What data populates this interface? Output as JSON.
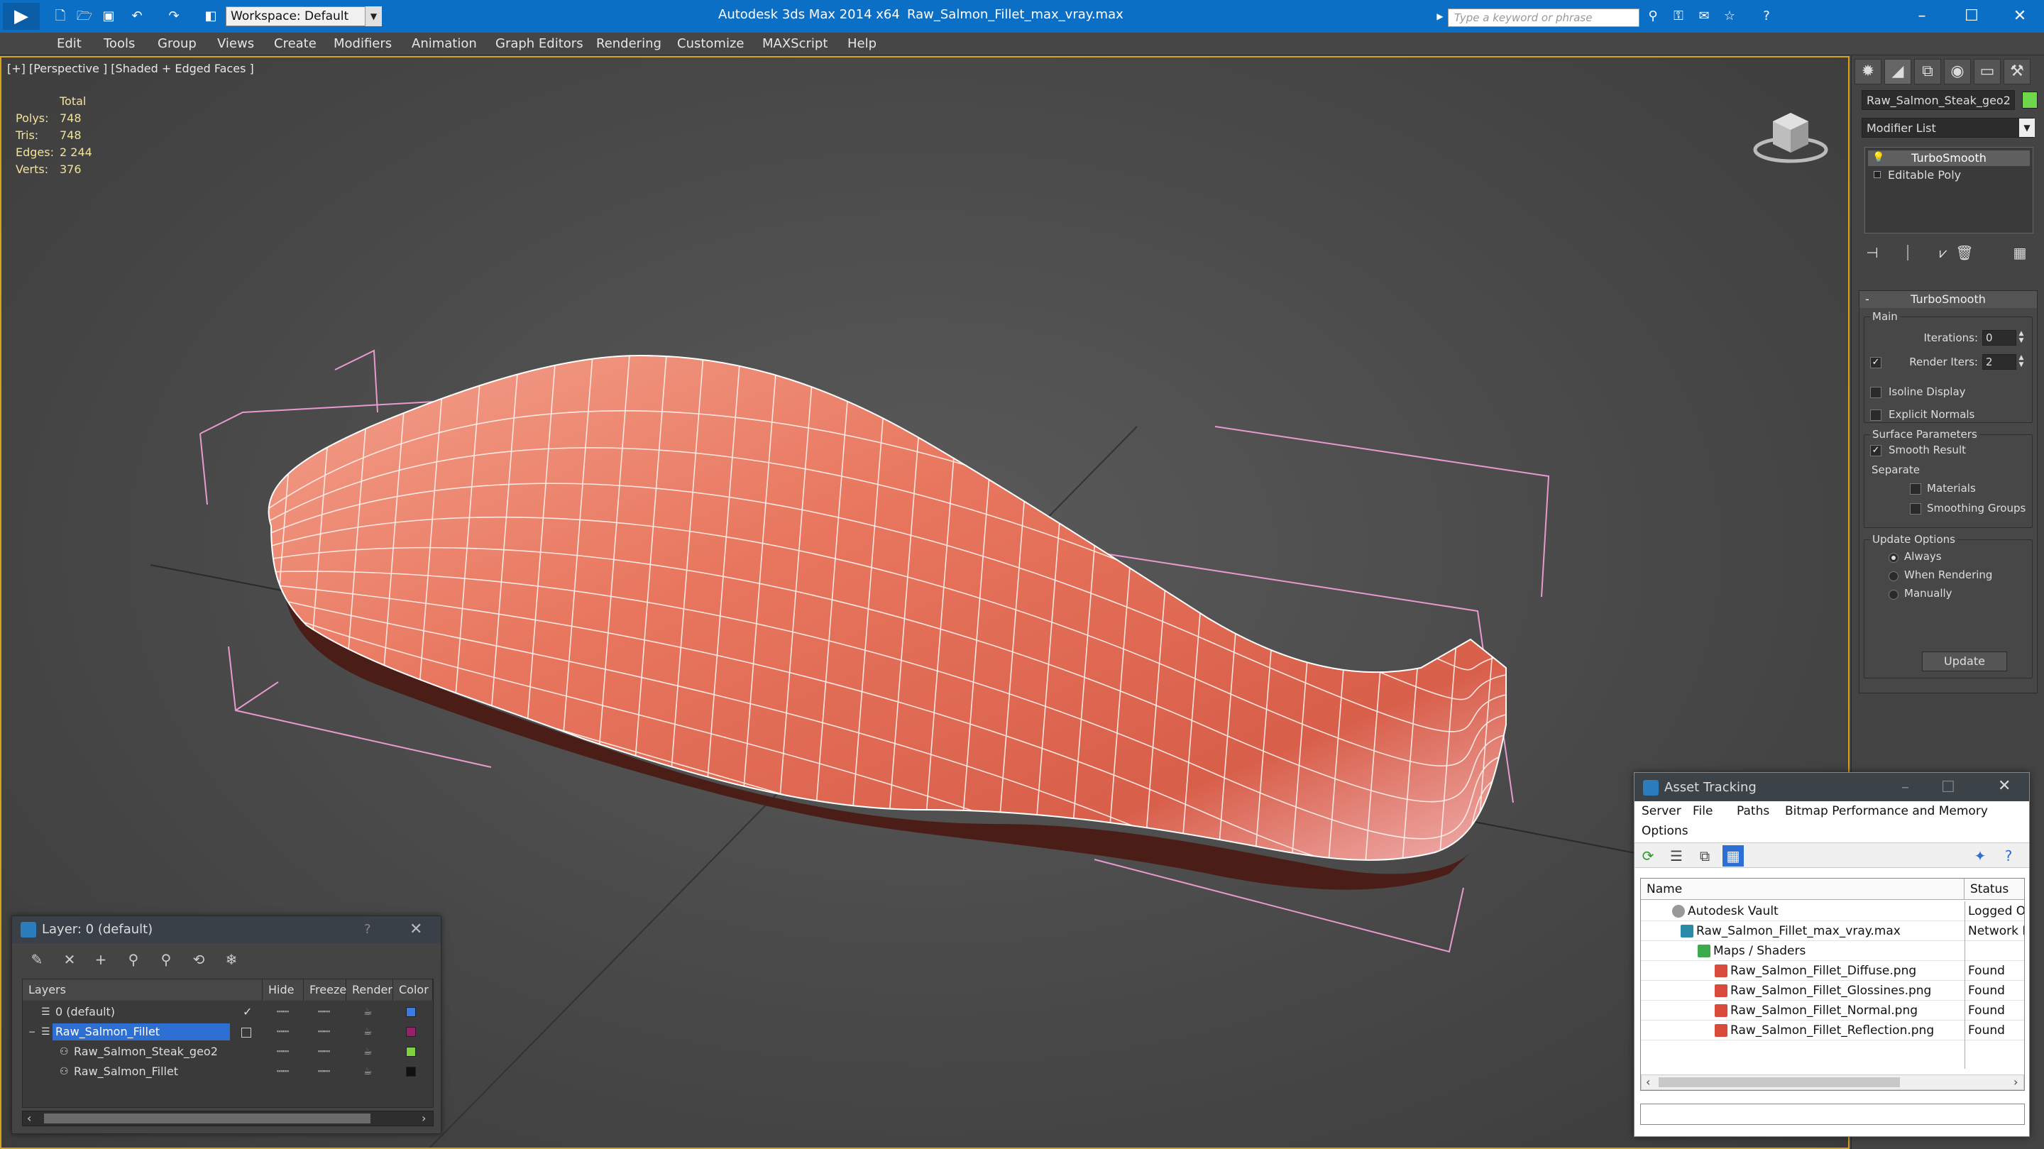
{
  "title_bar": {
    "app_title": "Autodesk 3ds Max  2014 x64",
    "file_title": "Raw_Salmon_Fillet_max_vray.max",
    "workspace_value": "Workspace: Default",
    "search_placeholder": "Type a keyword or phrase",
    "accent": "#0b6fc6"
  },
  "menu": {
    "items": [
      "Edit",
      "Tools",
      "Group",
      "Views",
      "Create",
      "Modifiers",
      "Animation",
      "Graph Editors",
      "Rendering",
      "Customize",
      "MAXScript",
      "Help"
    ]
  },
  "viewport": {
    "label": "[+] [Perspective ] [Shaded + Edged Faces ]",
    "stats": {
      "header": "Total",
      "rows": [
        {
          "label": "Polys:",
          "value": "748"
        },
        {
          "label": "Tris:",
          "value": "748"
        },
        {
          "label": "Edges:",
          "value": "2 244"
        },
        {
          "label": "Verts:",
          "value": "376"
        }
      ]
    }
  },
  "command_panel": {
    "object_name": "Raw_Salmon_Steak_geo2",
    "object_color": "#6dd84c",
    "modifier_list": "Modifier List",
    "stack": [
      "TurboSmooth",
      "Editable Poly"
    ],
    "rollout_title": "TurboSmooth",
    "main_group": "Main",
    "iterations_label": "Iterations:",
    "iterations_value": "0",
    "render_iters_label": "Render Iters:",
    "render_iters_value": "2",
    "render_iters_checked": true,
    "isoline_label": "Isoline Display",
    "explicit_normals_label": "Explicit Normals",
    "surface_group": "Surface Parameters",
    "smooth_result_label": "Smooth Result",
    "separate_label": "Separate",
    "materials_label": "Materials",
    "smoothing_groups_label": "Smoothing Groups",
    "update_group": "Update Options",
    "radio_always": "Always",
    "radio_when_rendering": "When Rendering",
    "radio_manually": "Manually",
    "update_button": "Update"
  },
  "layer_dialog": {
    "title": "Layer: 0 (default)",
    "help": "?",
    "columns": [
      "Layers",
      "Hide",
      "Freeze",
      "Render",
      "Color"
    ],
    "rows": [
      {
        "name": "0 (default)",
        "color": "#3b7be0",
        "indent": 1
      },
      {
        "name": "Raw_Salmon_Fillet",
        "color": "#9a1f6b",
        "indent": 1,
        "selected": true
      },
      {
        "name": "Raw_Salmon_Steak_geo2",
        "color": "#7ed23f",
        "indent": 2
      },
      {
        "name": "Raw_Salmon_Fillet",
        "color": "#111111",
        "indent": 2
      }
    ]
  },
  "asset_tracking": {
    "title": "Asset Tracking",
    "menu": [
      "Server",
      "File",
      "Paths",
      "Bitmap Performance and Memory",
      "Options"
    ],
    "columns": [
      "Name",
      "Status"
    ],
    "rows": [
      {
        "name": "Autodesk Vault",
        "status": "Logged O",
        "indent": 1,
        "icon": "vault-icon"
      },
      {
        "name": "Raw_Salmon_Fillet_max_vray.max",
        "status": "Network I",
        "indent": 2,
        "icon": "max-file-icon"
      },
      {
        "name": "Maps / Shaders",
        "status": "",
        "indent": 3,
        "icon": "maps-icon"
      },
      {
        "name": "Raw_Salmon_Fillet_Diffuse.png",
        "status": "Found",
        "indent": 4,
        "icon": "png-icon"
      },
      {
        "name": "Raw_Salmon_Fillet_Glossines.png",
        "status": "Found",
        "indent": 4,
        "icon": "png-icon"
      },
      {
        "name": "Raw_Salmon_Fillet_Normal.png",
        "status": "Found",
        "indent": 4,
        "icon": "png-icon"
      },
      {
        "name": "Raw_Salmon_Fillet_Reflection.png",
        "status": "Found",
        "indent": 4,
        "icon": "png-icon"
      }
    ]
  }
}
